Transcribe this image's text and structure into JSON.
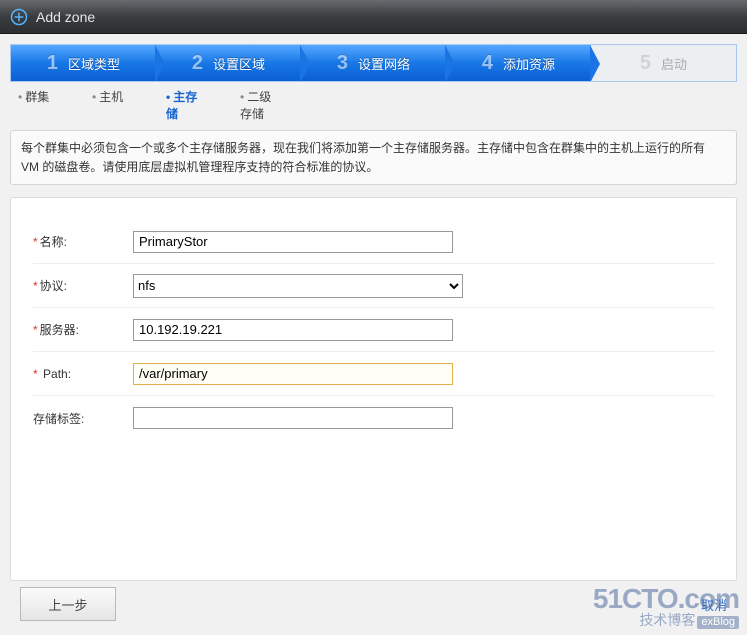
{
  "window": {
    "title": "Add zone"
  },
  "steps": [
    {
      "num": "1",
      "label": "区域类型",
      "state": "done"
    },
    {
      "num": "2",
      "label": "设置区域",
      "state": "done"
    },
    {
      "num": "3",
      "label": "设置网络",
      "state": "done"
    },
    {
      "num": "4",
      "label": "添加资源",
      "state": "done"
    },
    {
      "num": "5",
      "label": "启动",
      "state": "pending"
    }
  ],
  "substeps": [
    {
      "label": "群集",
      "current": false
    },
    {
      "label": "主机",
      "current": false
    },
    {
      "label": "主存储",
      "current": true
    },
    {
      "label": "二级存储",
      "current": false
    }
  ],
  "description": "每个群集中必须包含一个或多个主存储服务器，现在我们将添加第一个主存储服务器。主存储中包含在群集中的主机上运行的所有 VM 的磁盘卷。请使用底层虚拟机管理程序支持的符合标准的协议。",
  "form": {
    "name": {
      "label": "名称:",
      "value": "PrimaryStor",
      "required": true
    },
    "protocol": {
      "label": "协议:",
      "value": "nfs",
      "required": true
    },
    "server": {
      "label": "服务器:",
      "value": "10.192.19.221",
      "required": true
    },
    "path": {
      "label": "Path:",
      "value": "/var/primary",
      "required": true
    },
    "tag": {
      "label": "存储标签:",
      "value": "",
      "required": false
    }
  },
  "buttons": {
    "prev": "上一步",
    "cancel": "取消"
  },
  "watermark": {
    "line1": "51CTO.com",
    "line2": "技术博客",
    "box": "exBlog"
  }
}
